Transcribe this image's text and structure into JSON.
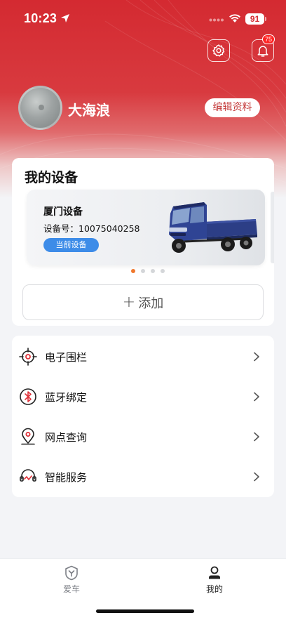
{
  "status_bar": {
    "time": "10:23",
    "battery": "91"
  },
  "header": {
    "notification_count": "75"
  },
  "profile": {
    "username": "大海浪",
    "edit_label": "编辑资料"
  },
  "devices": {
    "title": "我的设备",
    "items": [
      {
        "name": "厦门设备",
        "number_label": "设备号：10075040258",
        "status": "当前设备"
      }
    ],
    "page_count": 4,
    "active_page": 1,
    "add_label": "添加"
  },
  "menu": {
    "items": [
      {
        "label": "电子围栏",
        "icon": "geofence-icon"
      },
      {
        "label": "蓝牙绑定",
        "icon": "bluetooth-icon"
      },
      {
        "label": "网点查询",
        "icon": "location-pin-icon"
      },
      {
        "label": "智能服务",
        "icon": "smart-service-icon"
      }
    ]
  },
  "tab_bar": {
    "tabs": [
      {
        "label": "爱车",
        "icon": "car-shield-icon",
        "active": false
      },
      {
        "label": "我的",
        "icon": "user-icon",
        "active": true
      }
    ]
  },
  "colors": {
    "brand_red": "#d42a31",
    "active_blue": "#3d8ce8",
    "dot_active": "#f0782d"
  }
}
